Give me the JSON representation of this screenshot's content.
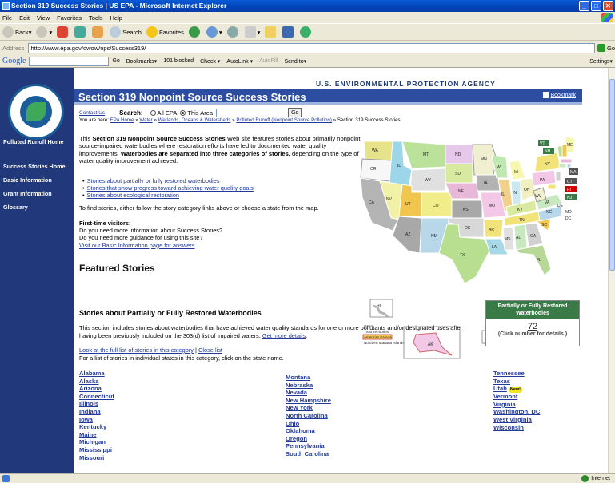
{
  "window": {
    "title": "Section 319 Success Stories | US EPA - Microsoft Internet Explorer",
    "buttons": [
      "_",
      "□",
      "✕"
    ]
  },
  "menu": [
    "File",
    "Edit",
    "View",
    "Favorites",
    "Tools",
    "Help"
  ],
  "toolbar": {
    "back": "Back",
    "search": "Search",
    "favorites": "Favorites"
  },
  "address": {
    "label": "Address",
    "url": "http://www.epa.gov/owow/nps/Success319/",
    "go": "Go"
  },
  "googlebar": {
    "logo": "Google",
    "go": "Go",
    "bookmarks": "Bookmarks▾",
    "blocked": "101 blocked",
    "check": "Check ▾",
    "autolink": "AutoLink ▾",
    "autofill": "AutoFill",
    "sendto": "Send to▾",
    "settings": "Settings▾"
  },
  "status": {
    "zone": "Internet"
  },
  "sidebar": {
    "items": [
      "Polluted Runoff Home",
      "Success Stories Home",
      "Basic Information",
      "Grant Information",
      "Glossary"
    ]
  },
  "header": {
    "agency": "U.S. ENVIRONMENTAL PROTECTION AGENCY",
    "title": "Section 319 Nonpoint Source Success Stories",
    "bookmark": "Bookmark"
  },
  "search": {
    "contact": "Contact Us",
    "label": "Search:",
    "opt1": "All EPA",
    "opt2": "This Area",
    "go": "Go"
  },
  "breadcrumb": {
    "prefix": "You are here:",
    "items": [
      "EPA Home",
      "Water",
      "Wetlands, Oceans & Watersheds",
      "Polluted Runoff (Nonpoint Source Pollution)"
    ],
    "current": "Section 319 Success Stories",
    "sep": "»"
  },
  "intro": {
    "p1": "This ",
    "b1": "Section 319 Nonpoint Source Success Stories",
    "p2": " Web site features stories about primarily nonpoint source-impaired waterbodies where restoration efforts have led to documented water quality improvements. ",
    "b2": "Waterbodies are separated into three categories of stories,",
    "p3": " depending on the type of water quality improvement achieved:"
  },
  "topics": [
    "Stories about partially or fully restored waterbodies",
    "Stories that show progress toward achieving water quality goals",
    "Stories about ecological restoration"
  ],
  "find_text": "To find stories, either follow the story category links above or choose a state from the map.",
  "visitors": {
    "heading": "First-time visitors:",
    "q1": "Do you need more information about Success Stories?",
    "q2": "Do you need more guidance for using this site?",
    "link": "Visit our Basic Information page for answers",
    "end": "."
  },
  "featured": "Featured Stories",
  "map": {
    "states": [
      "WA",
      "OR",
      "CA",
      "ID",
      "NV",
      "MT",
      "WY",
      "UT",
      "CO",
      "AZ",
      "NM",
      "ND",
      "SD",
      "NE",
      "KS",
      "OK",
      "TX",
      "MN",
      "IA",
      "MO",
      "AR",
      "LA",
      "WI",
      "IL",
      "MI",
      "IN",
      "OH",
      "KY",
      "TN",
      "MS",
      "AL",
      "GA",
      "FL",
      "SC",
      "NC",
      "VA",
      "WV",
      "PA",
      "NY",
      "ME",
      "VT",
      "NH",
      "MA",
      "CT",
      "RI",
      "NJ",
      "DE",
      "MD",
      "DC",
      "HI",
      "AK",
      "PR",
      "VI"
    ],
    "territories": [
      "Guam",
      "Trust Territories",
      "American Samoa",
      "Northern Mariana Islands"
    ]
  },
  "section": {
    "title": "Stories about Partially or Fully Restored Waterbodies",
    "desc": "This section includes stories about waterbodies that have achieved water quality standards for one or more pollutants and/or designated uses after having been previously included on the 303(d) list of impaired waters. ",
    "details": "Get more details",
    "period": ".",
    "full_list": "Look at the full list of stories in this category",
    "bar": " | ",
    "close_list": "Close list",
    "instruct": "For a list of stories in individual states in this category, click on the state name."
  },
  "badge": {
    "header": "Partially or Fully Restored Waterbodies",
    "count": "72",
    "sub": "(Click number for details.)"
  },
  "states_col1": [
    "Alabama",
    "Alaska",
    "Arizona",
    "Connecticut",
    "Illinois",
    "Indiana",
    "Iowa",
    "Kentucky",
    "Maine",
    "Michigan",
    "Mississippi",
    "Missouri"
  ],
  "states_col2": [
    "Montana",
    "Nebraska",
    "Nevada",
    "New Hampshire",
    "New York",
    "North Carolina",
    "Ohio",
    "Oklahoma",
    "Oregon",
    "Pennsylvania",
    "South Carolina"
  ],
  "states_col3": [
    "Tennessee",
    "Texas",
    "Utah",
    "Vermont",
    "Virginia",
    "Washington, DC",
    "West Virginia",
    "Wisconsin"
  ],
  "new_label": "New!",
  "colors": {
    "nav": "#21397a",
    "banner": "#2d4ea0",
    "link": "#21399a",
    "badge": "#3a7a47"
  }
}
